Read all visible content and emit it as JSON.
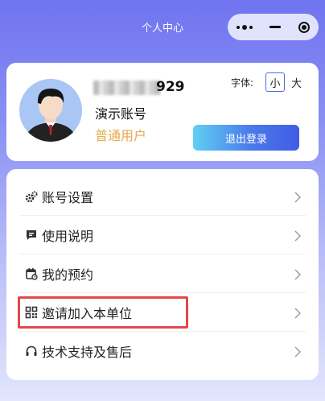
{
  "header": {
    "title": "个人中心",
    "capsule": {
      "more_icon": "more-dots-icon",
      "minimize_icon": "minus-icon",
      "close_icon": "target-icon"
    }
  },
  "profile": {
    "phone_visible_suffix": "929",
    "account_name": "演示账号",
    "user_type": "普通用户",
    "font_size": {
      "label": "字体:",
      "small": "小",
      "large": "大",
      "selected": "小"
    },
    "logout_label": "退出登录"
  },
  "menu": {
    "items": [
      {
        "label": "账号设置",
        "icon": "gear-icon"
      },
      {
        "label": "使用说明",
        "icon": "message-icon"
      },
      {
        "label": "我的预约",
        "icon": "calendar-icon"
      },
      {
        "label": "邀请加入本单位",
        "icon": "qrcode-icon"
      },
      {
        "label": "技术支持及售后",
        "icon": "headset-icon"
      }
    ]
  },
  "colors": {
    "accent": "#4b79ea",
    "user_type": "#e7a94a",
    "highlight": "#e4474a"
  }
}
